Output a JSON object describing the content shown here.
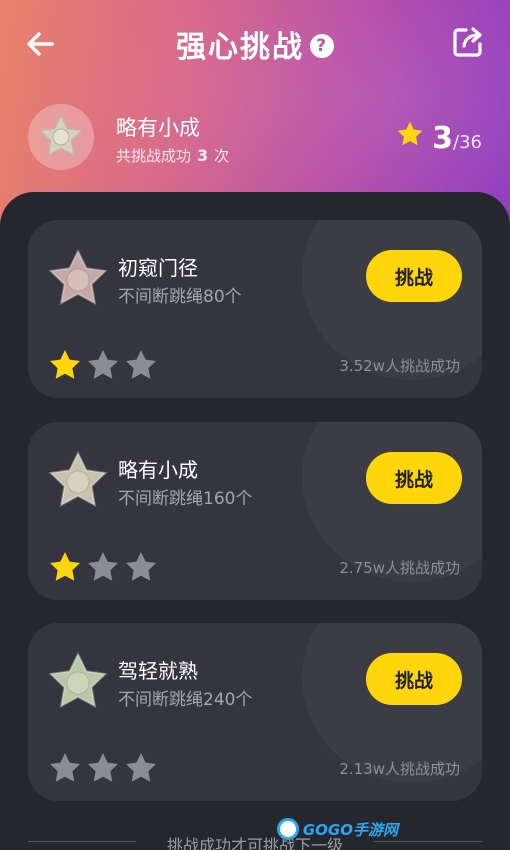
{
  "header": {
    "title": "强心挑战",
    "help_label": "?"
  },
  "profile": {
    "level_name": "略有小成",
    "success_prefix": "共挑战成功",
    "success_count": "3",
    "success_suffix": "次",
    "stars_earned": "3",
    "stars_total": "/36"
  },
  "challenges": [
    {
      "level": "初窥门径",
      "desc": "不间断跳绳80个",
      "button": "挑战",
      "count": "3.52w人挑战成功",
      "stars_filled": 1,
      "medal_color": "#c8a8a4"
    },
    {
      "level": "略有小成",
      "desc": "不间断跳绳160个",
      "button": "挑战",
      "count": "2.75w人挑战成功",
      "stars_filled": 1,
      "medal_color": "#c9c1ab"
    },
    {
      "level": "驾轻就熟",
      "desc": "不间断跳绳240个",
      "button": "挑战",
      "count": "2.13w人挑战成功",
      "stars_filled": 0,
      "medal_color": "#b9c8a6"
    }
  ],
  "footer": {
    "note": "挑战成功才可挑战下一级"
  },
  "watermark": {
    "text": "GOGO手游网"
  },
  "colors": {
    "accent": "#ffd50b",
    "star_filled": "#ffd50b",
    "star_empty": "#8b8c94"
  }
}
